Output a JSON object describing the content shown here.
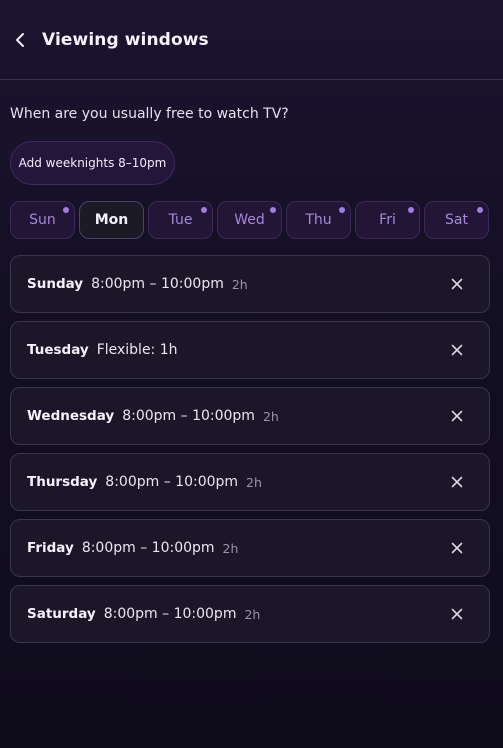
{
  "header": {
    "title": "Viewing windows",
    "back_icon": "chevron-left-icon"
  },
  "prompt": "When are you usually free to watch TV?",
  "add_button_label": "Add weeknights 8–10pm",
  "colors": {
    "accent": "#a27ee0",
    "day_chip_bg": "#221535",
    "card_bg": "#1b1628"
  },
  "days": [
    {
      "label": "Sun",
      "selected": false,
      "has_window": true
    },
    {
      "label": "Mon",
      "selected": true,
      "has_window": false
    },
    {
      "label": "Tue",
      "selected": false,
      "has_window": true
    },
    {
      "label": "Wed",
      "selected": false,
      "has_window": true
    },
    {
      "label": "Thu",
      "selected": false,
      "has_window": true
    },
    {
      "label": "Fri",
      "selected": false,
      "has_window": true
    },
    {
      "label": "Sat",
      "selected": false,
      "has_window": true
    }
  ],
  "windows": [
    {
      "day": "Sunday",
      "time": "8:00pm – 10:00pm",
      "duration": "2h"
    },
    {
      "day": "Tuesday",
      "time": "Flexible: 1h",
      "duration": ""
    },
    {
      "day": "Wednesday",
      "time": "8:00pm – 10:00pm",
      "duration": "2h"
    },
    {
      "day": "Thursday",
      "time": "8:00pm – 10:00pm",
      "duration": "2h"
    },
    {
      "day": "Friday",
      "time": "8:00pm – 10:00pm",
      "duration": "2h"
    },
    {
      "day": "Saturday",
      "time": "8:00pm – 10:00pm",
      "duration": "2h"
    }
  ]
}
